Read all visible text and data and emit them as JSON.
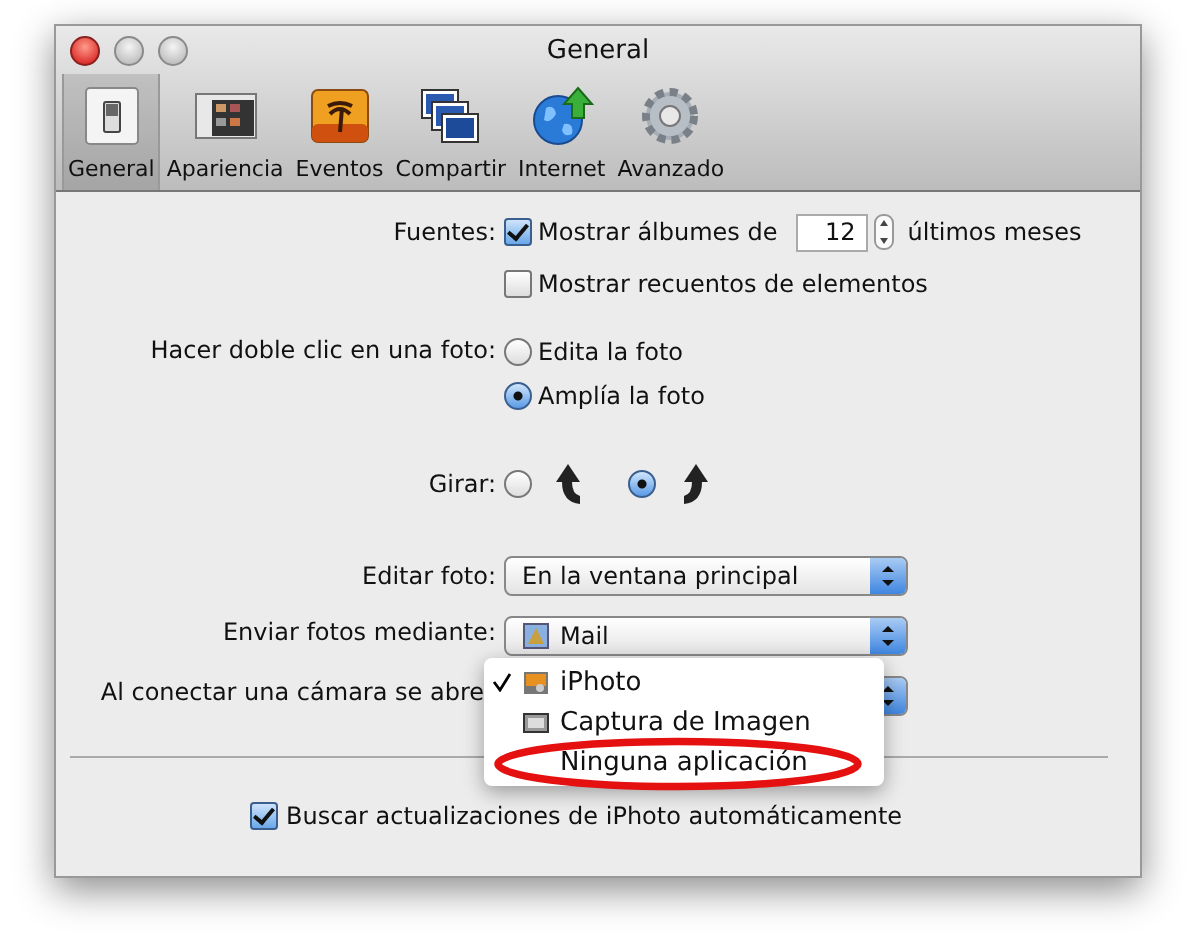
{
  "window": {
    "title": "General"
  },
  "toolbar": [
    {
      "label": "General",
      "kind": "switch",
      "selected": true
    },
    {
      "label": "Apariencia",
      "kind": "appearance",
      "selected": false
    },
    {
      "label": "Eventos",
      "kind": "events",
      "selected": false
    },
    {
      "label": "Compartir",
      "kind": "share",
      "selected": false
    },
    {
      "label": "Internet",
      "kind": "globe",
      "selected": false
    },
    {
      "label": "Avanzado",
      "kind": "gear",
      "selected": false
    }
  ],
  "sources": {
    "label": "Fuentes:",
    "show_albums": {
      "label_before": "Mostrar álbumes de",
      "value": "12",
      "label_after": "últimos meses",
      "checked": true
    },
    "show_counts": {
      "label": "Mostrar recuentos de elementos",
      "checked": false
    }
  },
  "double_click": {
    "label": "Hacer doble clic en una foto:",
    "options": [
      {
        "label": "Edita la foto",
        "selected": false
      },
      {
        "label": "Amplía la foto",
        "selected": true
      }
    ]
  },
  "rotate": {
    "label": "Girar:",
    "options": [
      {
        "kind": "counterclockwise",
        "selected": false
      },
      {
        "kind": "clockwise",
        "selected": true
      }
    ]
  },
  "edit_photo": {
    "label": "Editar foto:",
    "value": "En la ventana principal"
  },
  "email_via": {
    "label": "Enviar fotos mediante:",
    "value": "Mail"
  },
  "camera_opens": {
    "label": "Al conectar una cámara se abre",
    "menu": [
      {
        "label": "iPhoto",
        "kind": "iphoto",
        "selected": true,
        "circled": false
      },
      {
        "label": "Captura de Imagen",
        "kind": "capture",
        "selected": false,
        "circled": false
      },
      {
        "label": "Ninguna aplicación",
        "kind": "none",
        "selected": false,
        "circled": true
      }
    ]
  },
  "check_updates": {
    "label": "Buscar actualizaciones de iPhoto automáticamente",
    "checked": true
  }
}
